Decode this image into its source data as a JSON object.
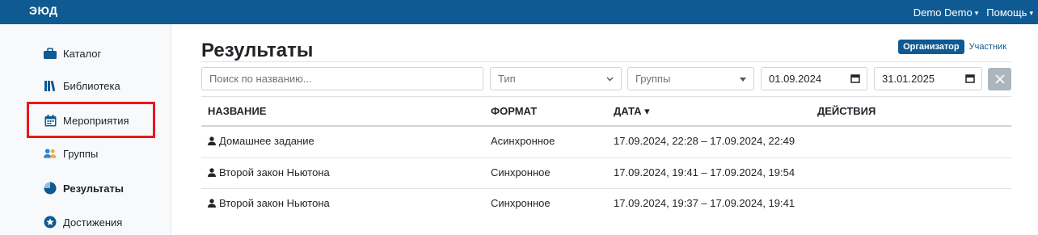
{
  "header": {
    "logo": "ЭЮД",
    "user_menu": "Demo Demo",
    "help_menu": "Помощь"
  },
  "sidebar": {
    "items": [
      {
        "label": "Каталог",
        "icon": "catalog-icon"
      },
      {
        "label": "Библиотека",
        "icon": "library-icon"
      },
      {
        "label": "Мероприятия",
        "icon": "calendar-icon"
      },
      {
        "label": "Группы",
        "icon": "groups-icon"
      },
      {
        "label": "Результаты",
        "icon": "results-icon"
      },
      {
        "label": "Достижения",
        "icon": "achievements-icon"
      }
    ]
  },
  "page": {
    "title": "Результаты",
    "role_organizer": "Организатор",
    "role_participant": "Участник"
  },
  "filters": {
    "search_placeholder": "Поиск по названию...",
    "type_placeholder": "Тип",
    "groups_placeholder": "Группы",
    "date_from": "01.09.2024",
    "date_to": "31.01.2025"
  },
  "table": {
    "headers": [
      "НАЗВАНИЕ",
      "ФОРМАТ",
      "ДАТА ▾",
      "ДЕЙСТВИЯ"
    ],
    "rows": [
      {
        "name": "Домашнее задание",
        "format": "Асинхронное",
        "date": "17.09.2024, 22:28 – 17.09.2024, 22:49"
      },
      {
        "name": "Второй закон Ньютона",
        "format": "Синхронное",
        "date": "17.09.2024, 19:41 – 17.09.2024, 19:54"
      },
      {
        "name": "Второй закон Ньютона",
        "format": "Синхронное",
        "date": "17.09.2024, 19:37 – 17.09.2024, 19:41"
      }
    ]
  },
  "colors": {
    "brand": "#0f5a92",
    "highlight": "#e8171d"
  }
}
